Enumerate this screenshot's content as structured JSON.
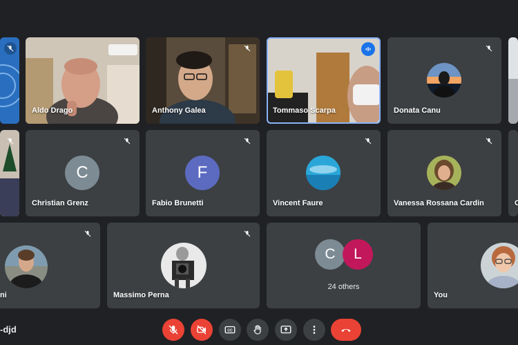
{
  "participants": {
    "aldo": "Aldo Drago",
    "anthony": "Anthony Galea",
    "tommaso": "Tommaso Scarpa",
    "donata": "Donata Canu",
    "christian": "Christian Grenz",
    "christian_initial": "C",
    "fabio": "Fabio Brunetti",
    "fabio_initial": "F",
    "vincent": "Vincent Faure",
    "vanessa": "Vanessa Rossana Cardin",
    "row3_left_partial": "ni",
    "massimo": "Massimo Perna",
    "others_count": "24 others",
    "others_initial_1": "C",
    "others_initial_2": "L",
    "you": "You",
    "row2_right_partial": "C"
  },
  "meeting": {
    "code_partial": "-djd"
  },
  "colors": {
    "background": "#202124",
    "tile": "#3c4043",
    "speaking_border": "#8ab4f8",
    "end_call": "#ea4335",
    "avatar_c_grey": "#7d8b94",
    "avatar_f_indigo": "#5c6bc0",
    "avatar_l_magenta": "#c2185b"
  },
  "controls": [
    {
      "icon": "mic-off-icon",
      "state": "off"
    },
    {
      "icon": "camera-off-icon",
      "state": "off"
    },
    {
      "icon": "captions-icon"
    },
    {
      "icon": "raise-hand-icon"
    },
    {
      "icon": "present-screen-icon"
    },
    {
      "icon": "more-options-icon"
    },
    {
      "icon": "end-call-icon"
    }
  ]
}
